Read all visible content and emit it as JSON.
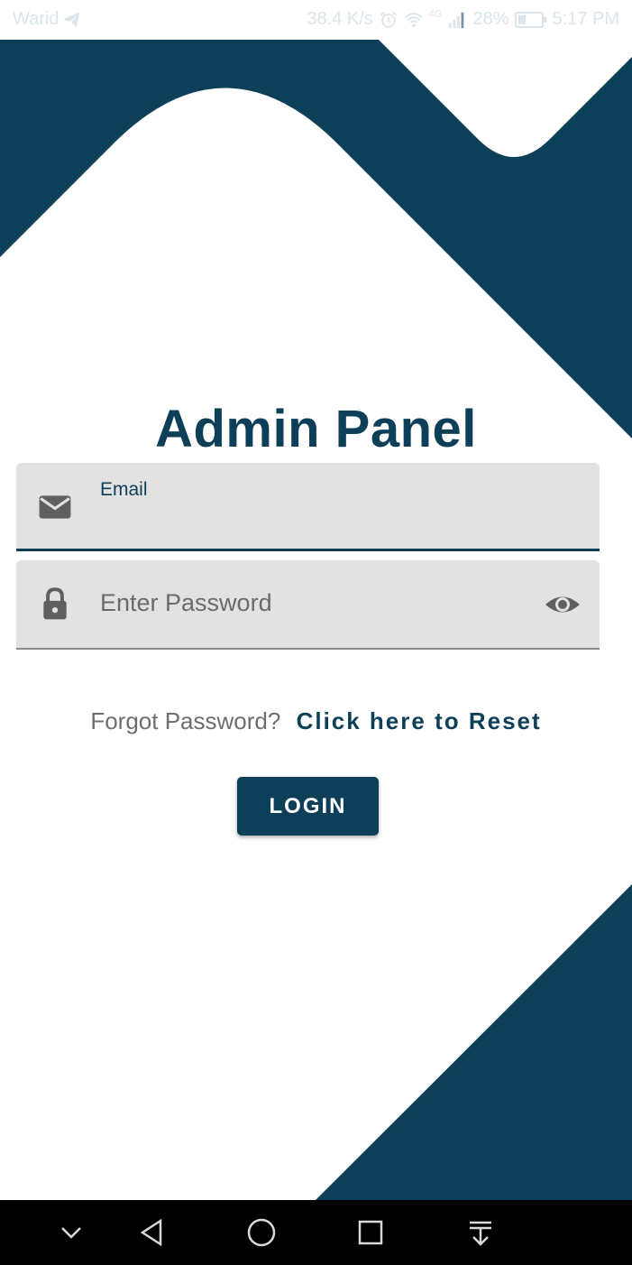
{
  "colors": {
    "brand": "#0e3f58",
    "field_bg": "#e2e2e2",
    "muted_text": "#6e6e6e",
    "nav_bg": "#000000"
  },
  "status_bar": {
    "carrier": "Warid",
    "network_speed": "38.4 K/s",
    "network_type": "4G",
    "battery_percent": "28%",
    "time": "5:17 PM",
    "icons": [
      "telegram-icon",
      "alarm-icon",
      "wifi-icon",
      "signal-icon",
      "battery-icon"
    ]
  },
  "login": {
    "title": "Admin Panel",
    "email": {
      "label": "Email",
      "value": "",
      "icon": "mail-icon"
    },
    "password": {
      "placeholder": "Enter Password",
      "value": "",
      "icon": "lock-icon",
      "toggle_icon": "eye-icon"
    },
    "forgot_text": "Forgot Password?",
    "reset_link": "Click here to Reset",
    "login_button": "LOGIN"
  },
  "nav_bar": {
    "buttons": [
      "chevron-down-icon",
      "back-icon",
      "home-icon",
      "recents-icon",
      "notification-pull-icon"
    ]
  }
}
